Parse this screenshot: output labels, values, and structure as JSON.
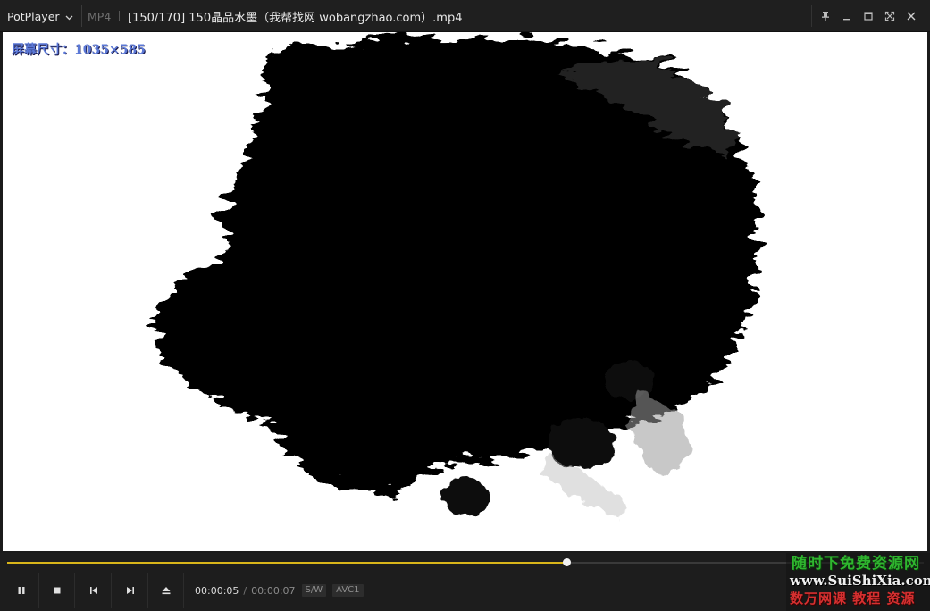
{
  "window": {
    "app_name": "PotPlayer",
    "format": "MP4",
    "title": "[150/170] 150晶品水墨（我帮找网 wobangzhao.com）.mp4"
  },
  "video": {
    "osd_text": "屏幕尺寸：1035×585"
  },
  "playback": {
    "current_time": "00:00:05",
    "separator": "/",
    "total_time": "00:00:07",
    "progress_fraction": 0.61,
    "badges": [
      "S/W",
      "AVC1"
    ]
  },
  "watermark": {
    "line1": "随时下免费资源网",
    "line2": "www.SuiShiXia.com",
    "line3": "数万网课 教程 资源"
  },
  "icons": {
    "menu": "chevron-down-icon",
    "pin": "pin-icon",
    "minimize": "minimize-icon",
    "maximize": "maximize-icon",
    "fullscreen": "fullscreen-icon",
    "close": "close-icon",
    "pause": "pause-icon",
    "stop": "stop-icon",
    "previous": "previous-icon",
    "next": "next-icon",
    "eject": "eject-icon"
  },
  "colors": {
    "accent": "#d9b51a",
    "osd": "#5b78d6"
  }
}
